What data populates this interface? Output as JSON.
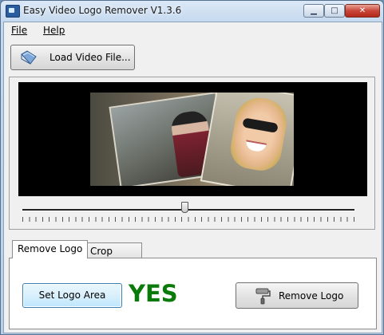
{
  "window": {
    "title": "Easy Video Logo Remover V1.3.6",
    "minimize_glyph": "▁",
    "maximize_glyph": "□",
    "close_glyph": "✕",
    "icons": {
      "app": "app-icon",
      "minimize": "minimize-icon",
      "maximize": "maximize-icon",
      "close": "close-icon"
    }
  },
  "menu": {
    "file": "File",
    "help": "Help"
  },
  "toolbar": {
    "load_video_label": "Load Video File...",
    "load_icon": "folder-icon"
  },
  "player": {
    "position_fraction": 0.49
  },
  "tabs": [
    {
      "label": "Remove Logo",
      "selected": true
    },
    {
      "label": "Crop Video",
      "selected": false
    }
  ],
  "remove_logo": {
    "set_area_label": "Set Logo Area",
    "status": "YES",
    "status_color": "#0a7a0a",
    "remove_label": "Remove Logo",
    "remove_icon": "paint-roller-icon"
  }
}
